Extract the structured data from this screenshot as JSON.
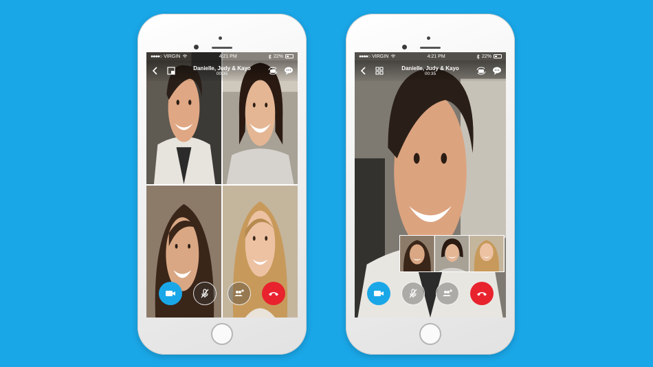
{
  "status": {
    "carrier": "VIRGIN",
    "time": "4:21 PM",
    "battery": "22%"
  },
  "call": {
    "title": "Danielle, Judy & Kayo",
    "timer": "00:35"
  },
  "colors": {
    "background": "#1aa7e8",
    "video_button": "#1aa7e8",
    "end_button": "#e8232e"
  },
  "icons": {
    "back": "back-arrow-icon",
    "layout_single": "single-view-icon",
    "layout_grid": "grid-view-icon",
    "switch_camera": "switch-camera-icon",
    "chat": "chat-icon",
    "video": "video-camera-icon",
    "mute": "mute-mic-icon",
    "add_people": "add-people-icon",
    "end_call": "end-call-icon"
  }
}
